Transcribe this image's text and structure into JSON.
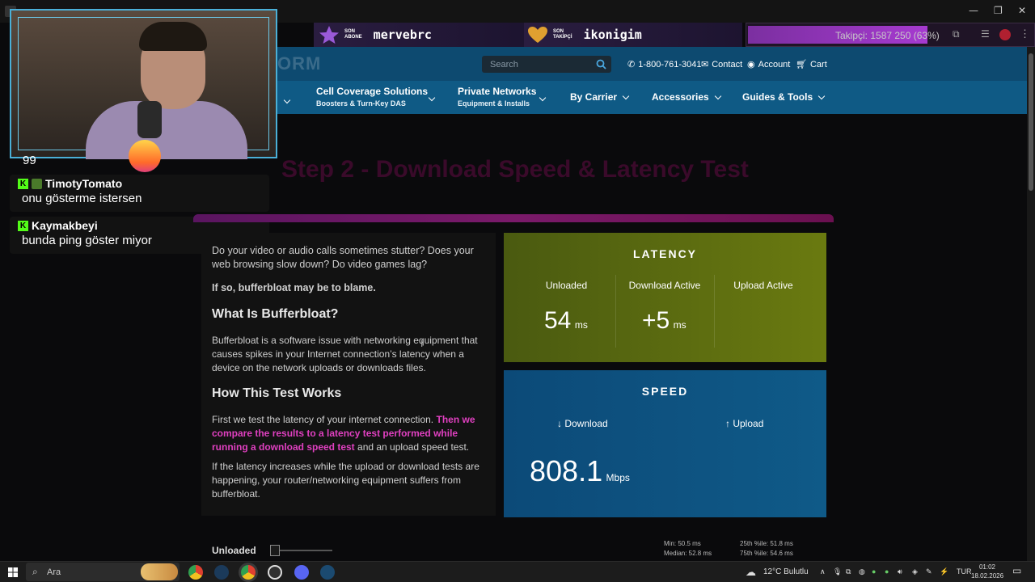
{
  "stream_overlay": {
    "alerts": [
      {
        "tag": "SON\nABONE",
        "username": "mervebrc",
        "icon": "star-icon"
      },
      {
        "tag": "SON\nTAKİPÇİ",
        "username": "ikonigim",
        "icon": "heart-icon"
      }
    ],
    "follower_goal": "Takipçi: 1587 250 (63%)",
    "follower_progress": 0.63
  },
  "chat": {
    "partial_line": "99",
    "messages": [
      {
        "user": "TimotyTomato",
        "text": "onu gösterme istersen"
      },
      {
        "user": "Kaymakbeyi",
        "text": "bunda ping göster miyor"
      }
    ]
  },
  "site": {
    "logo_partial": "ORM",
    "search_placeholder": "Search",
    "phone": "1-800-761-3041",
    "contact": "Contact",
    "account": "Account",
    "cart": "Cart",
    "nav": [
      {
        "label": "Cell Coverage Solutions",
        "sub": "Boosters & Turn-Key DAS"
      },
      {
        "label": "Private Networks",
        "sub": "Equipment & Installs"
      },
      {
        "label": "By Carrier",
        "sub": ""
      },
      {
        "label": "Accessories",
        "sub": ""
      },
      {
        "label": "Guides & Tools",
        "sub": ""
      }
    ]
  },
  "page": {
    "step_title": "Step 2 - Download Speed & Latency Test",
    "intro": "Do your video or audio calls sometimes stutter? Does your web browsing slow down? Do video games lag?",
    "blame": "If so, bufferbloat may be to blame.",
    "h_what": "What Is Bufferbloat?",
    "what_text": "Bufferbloat is a software issue with networking equipment that causes spikes in your Internet connection’s latency when a device on the network uploads or downloads files.",
    "h_how": "How This Test Works",
    "how_text_1a": "First we test the latency of your internet connection. ",
    "how_text_1b": "Then we compare the results to a latency test performed while running a download speed test",
    "how_text_1c": " and an upload speed test.",
    "how_text_2": "If the latency increases while the upload or download tests are happening, your router/networking equipment suffers from bufferbloat."
  },
  "latency": {
    "title": "LATENCY",
    "columns": [
      "Unloaded",
      "Download Active",
      "Upload Active"
    ],
    "values": [
      "54",
      "+5",
      ""
    ],
    "unit": "ms"
  },
  "speed": {
    "title": "SPEED",
    "download_label": "↓ Download",
    "upload_label": "↑ Upload",
    "download_value": "808.1",
    "unit": "Mbps"
  },
  "stats": {
    "unloaded_label": "Unloaded",
    "min": "Min: 50.5 ms",
    "median": "Median: 52.8 ms",
    "p25": "25th %ile: 51.8 ms",
    "p75": "75th %ile: 54.6 ms"
  },
  "taskbar": {
    "search": "Ara",
    "weather": "12°C  Bulutlu",
    "lang": "TUR",
    "time": "01:02",
    "date": "18.02.2026"
  },
  "colors": {
    "pink_accent": "#e040c0",
    "latency_card": "#5f7010",
    "speed_card": "#0f5a88",
    "nav_blue": "#0f5a85",
    "kick_green": "#53fc18"
  }
}
